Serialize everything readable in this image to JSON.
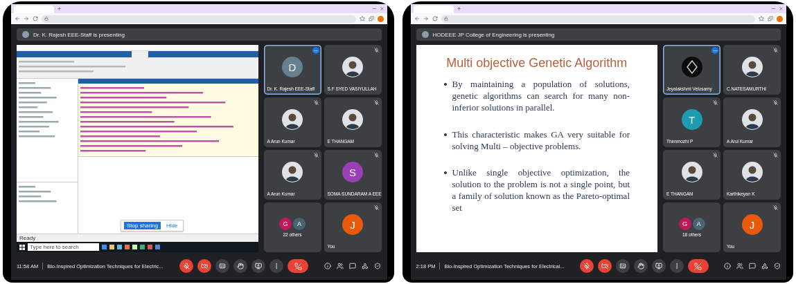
{
  "screens": [
    {
      "presenter_banner": "Dr. K. Rajesh EEE-Staff is presenting",
      "shared": {
        "kind": "desktop",
        "status": "Ready",
        "taskbar_search_placeholder": "Type here to search",
        "notice_buttons": [
          "Stop sharing",
          "Hide"
        ]
      },
      "tiles": [
        {
          "kind": "letter",
          "letter": "D",
          "color": "#66808f",
          "name": "Dr. K. Rajesh EEE-Staff",
          "selected": true,
          "speaking": true,
          "muted": false
        },
        {
          "kind": "photo",
          "name": "S.F SYED VASIYULLAH",
          "selected": false,
          "speaking": false,
          "muted": true
        },
        {
          "kind": "photo",
          "name": "A Arun Kumar",
          "selected": false,
          "speaking": false,
          "muted": true
        },
        {
          "kind": "photo",
          "name": "E THANGAM",
          "selected": false,
          "speaking": false,
          "muted": true
        },
        {
          "kind": "photo",
          "name": "A Arun Kumar",
          "selected": false,
          "speaking": false,
          "muted": true
        },
        {
          "kind": "letter",
          "letter": "S",
          "color": "#9b3fb8",
          "name": "SOMA SUNDARAM A EEE",
          "selected": false,
          "speaking": false,
          "muted": true
        },
        {
          "kind": "group",
          "letters": [
            {
              "letter": "G",
              "color": "#c2185b"
            },
            {
              "letter": "A",
              "color": "#4a6572"
            }
          ],
          "name": "22 others",
          "selected": false,
          "speaking": false,
          "muted": false
        },
        {
          "kind": "letter",
          "letter": "J",
          "color": "#e8590c",
          "name": "You",
          "selected": false,
          "speaking": false,
          "muted": true
        }
      ],
      "bottom": {
        "time": "11:58 AM",
        "meeting_title": "Bio-Inspired Optimization Techniques for Electric..."
      },
      "controls": [
        {
          "kind": "mic",
          "off": true
        },
        {
          "kind": "camera",
          "off": true
        },
        {
          "kind": "captions",
          "off": false
        },
        {
          "kind": "hand",
          "off": false
        },
        {
          "kind": "present",
          "off": false
        },
        {
          "kind": "more",
          "off": false
        },
        {
          "kind": "end",
          "off": true
        }
      ]
    },
    {
      "presenter_banner": "HODEEE JP College of Engineering is presenting",
      "shared": {
        "kind": "slide",
        "title": "Multi objective Genetic Algorithm",
        "bullets": [
          "By maintaining a population of solutions, genetic algorithms can search for many non-inferior solutions in parallel.",
          "This characteristic makes GA very suitable for solving Multi – objective problems.",
          "Unlike single objective optimization, the solution to the problem is not a single point, but a family of solution known as the Pareto-optimal set"
        ]
      },
      "tiles": [
        {
          "kind": "logo",
          "name": "Jeyalakshmi Velusamy",
          "selected": true,
          "speaking": true,
          "muted": false
        },
        {
          "kind": "photo",
          "name": "C.NATESAMURTHI",
          "selected": false,
          "speaking": false,
          "muted": true
        },
        {
          "kind": "letter",
          "letter": "T",
          "color": "#1e9bb0",
          "name": "Thenmozhi P",
          "selected": false,
          "speaking": false,
          "muted": true
        },
        {
          "kind": "photo",
          "name": "A Arul Kumar",
          "selected": false,
          "speaking": false,
          "muted": true
        },
        {
          "kind": "photo",
          "name": "E THANGAM",
          "selected": false,
          "speaking": false,
          "muted": true
        },
        {
          "kind": "photo",
          "name": "Karthikeyan K",
          "selected": false,
          "speaking": false,
          "muted": true
        },
        {
          "kind": "group",
          "letters": [
            {
              "letter": "G",
              "color": "#c2185b"
            },
            {
              "letter": "A",
              "color": "#4a6572"
            }
          ],
          "name": "18 others",
          "selected": false,
          "speaking": false,
          "muted": false
        },
        {
          "kind": "letter",
          "letter": "J",
          "color": "#e8590c",
          "name": "You",
          "selected": false,
          "speaking": false,
          "muted": true
        }
      ],
      "bottom": {
        "time": "2:18 PM",
        "meeting_title": "Bio-Inspired Optimization Techniques for Electrical..."
      },
      "controls": [
        {
          "kind": "mic",
          "off": true
        },
        {
          "kind": "camera",
          "off": true
        },
        {
          "kind": "captions",
          "off": false
        },
        {
          "kind": "hand",
          "off": false
        },
        {
          "kind": "present",
          "off": false
        },
        {
          "kind": "more",
          "off": false
        },
        {
          "kind": "end",
          "off": true
        }
      ]
    }
  ]
}
